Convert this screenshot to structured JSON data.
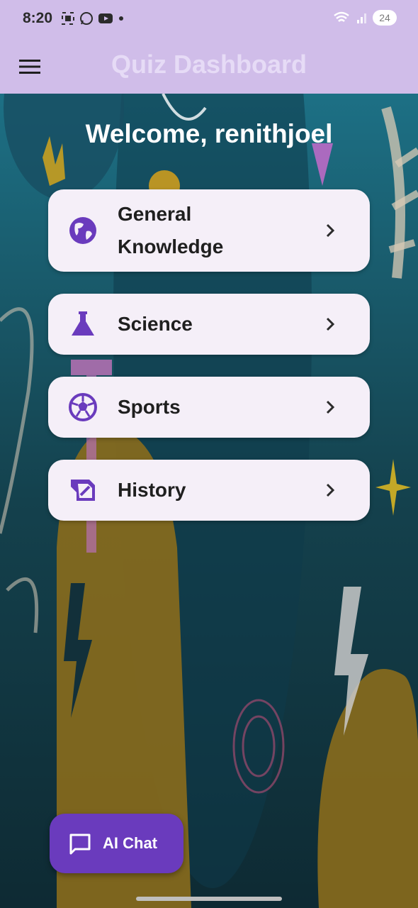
{
  "status_bar": {
    "time": "8:20",
    "battery": "24"
  },
  "app_bar": {
    "title": "Quiz Dashboard"
  },
  "welcome": "Welcome, renithjoel",
  "categories": [
    {
      "label_line1": "General",
      "label_line2": "Knowledge",
      "icon": "globe-icon"
    },
    {
      "label": "Science",
      "icon": "flask-icon"
    },
    {
      "label": "Sports",
      "icon": "soccer-ball-icon"
    },
    {
      "label": "History",
      "icon": "history-edu-icon"
    }
  ],
  "fab": {
    "label": "AI Chat",
    "icon": "chat-bubble-icon"
  },
  "colors": {
    "app_bar": "#d0bde9",
    "card": "#f5eff8",
    "accent": "#6a3bbd"
  }
}
